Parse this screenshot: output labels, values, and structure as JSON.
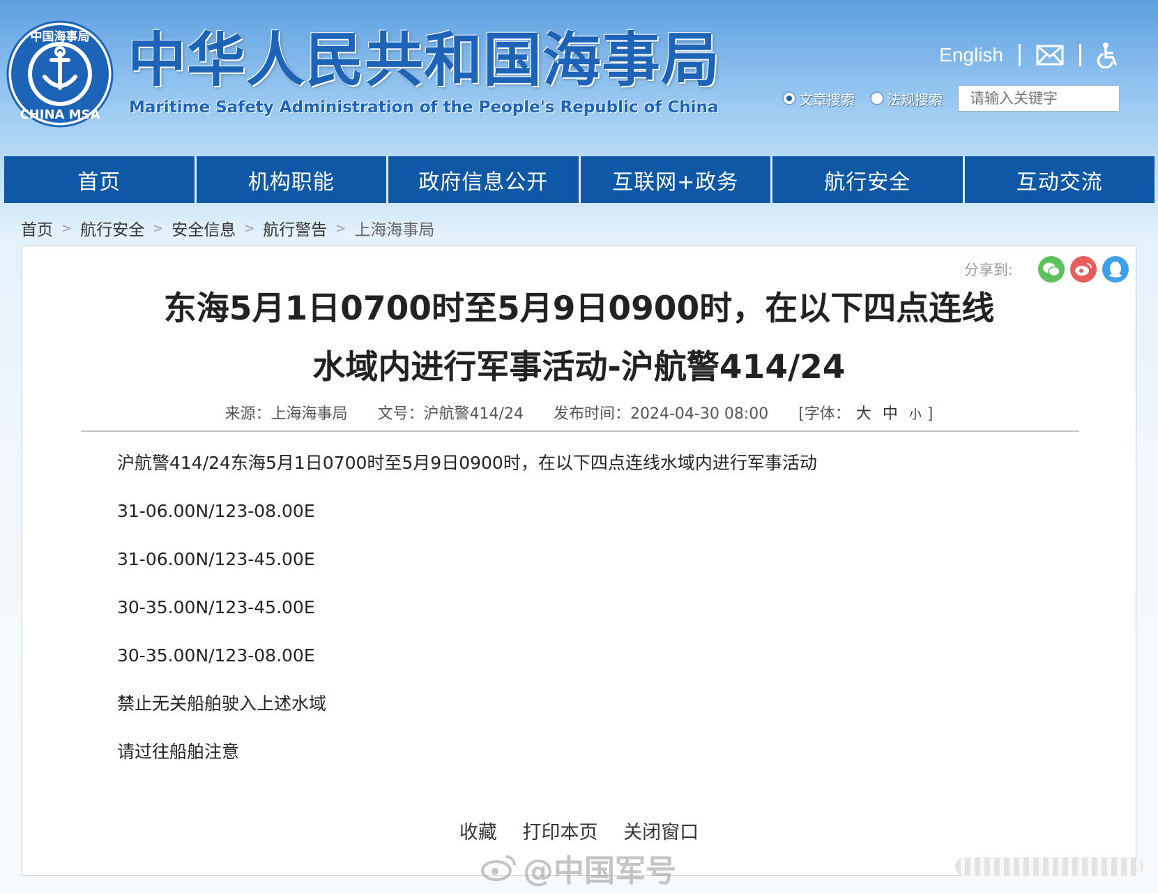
{
  "header": {
    "logo_text_top": "中国海事局",
    "logo_text_bottom": "CHINA MSA",
    "title_cn": "中华人民共和国海事局",
    "title_en": "Maritime Safety Administration of the People's Republic of China",
    "english_link": "English",
    "search": {
      "option_article": "文章搜索",
      "option_law": "法规搜索",
      "placeholder": "请输入关键字"
    },
    "icons": [
      "mail-icon",
      "accessibility-icon"
    ]
  },
  "nav": {
    "items": [
      "首页",
      "机构职能",
      "政府信息公开",
      "互联网+政务",
      "航行安全",
      "互动交流"
    ]
  },
  "breadcrumb": [
    "首页",
    "航行安全",
    "安全信息",
    "航行警告",
    "上海海事局"
  ],
  "article": {
    "share_label": "分享到:",
    "title_line1": "东海5月1日0700时至5月9日0900时，在以下四点连线",
    "title_line2": "水域内进行军事活动-沪航警414/24",
    "source": "来源：上海海事局",
    "doc_no": "文号：沪航警414/24",
    "published": "发布时间：2024-04-30 08:00",
    "font_label": "[字体：",
    "font_large": "大",
    "font_medium": "中",
    "font_small": "小",
    "font_close": "]",
    "paragraphs": [
      "沪航警414/24东海5月1日0700时至5月9日0900时，在以下四点连线水域内进行军事活动",
      "31-06.00N/123-08.00E",
      "31-06.00N/123-45.00E",
      "30-35.00N/123-45.00E",
      "30-35.00N/123-08.00E",
      "禁止无关船舶驶入上述水域",
      "请过往船舶注意"
    ],
    "actions": [
      "收藏",
      "打印本页",
      "关闭窗口"
    ]
  },
  "watermark": "@中国军号",
  "colors": {
    "nav_bg": "#0f58a6",
    "brand_blue": "#1d63b8",
    "share_wechat": "#5dc15c",
    "share_weibo": "#e85c5c",
    "share_qq": "#3fa0ea"
  }
}
